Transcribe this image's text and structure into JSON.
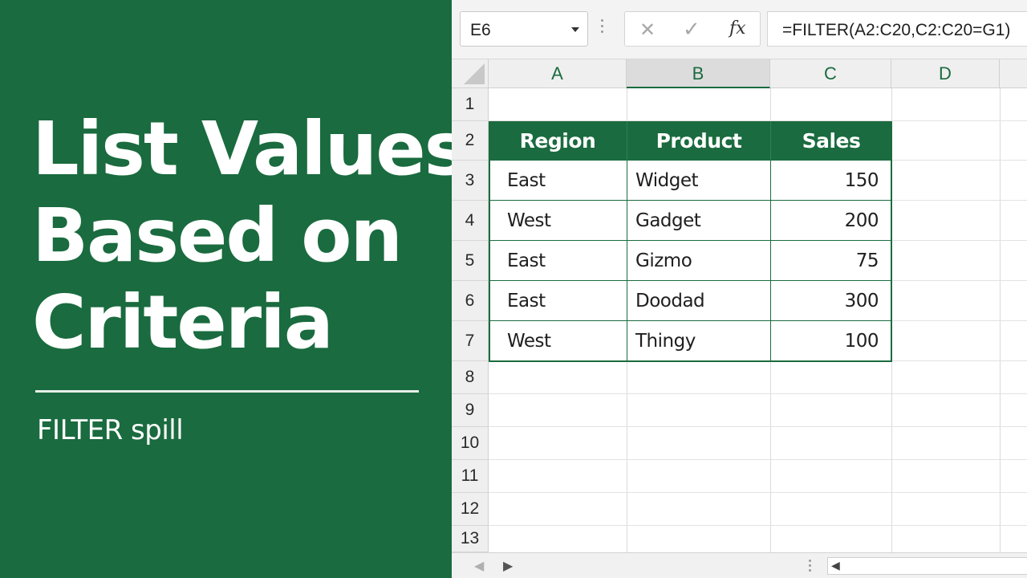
{
  "panel": {
    "title_lines": [
      "List Values",
      "Based on",
      "Criteria"
    ],
    "subtitle": "FILTER spill"
  },
  "formula_bar": {
    "name_box": "E6",
    "cancel_icon": "close-icon",
    "enter_icon": "check-icon",
    "fx_label": "fx",
    "formula": "=FILTER(A2:C20,C2:C20=G1)"
  },
  "grid": {
    "columns": [
      "A",
      "B",
      "C",
      "D"
    ],
    "active_column": "B",
    "rows": [
      "1",
      "2",
      "3",
      "4",
      "5",
      "6",
      "7",
      "8",
      "9",
      "10",
      "11",
      "12",
      "13"
    ]
  },
  "table": {
    "headers": [
      "Region",
      "Product",
      "Sales"
    ],
    "rows": [
      [
        "East",
        "Widget",
        "150"
      ],
      [
        "West",
        "Gadget",
        "200"
      ],
      [
        "East",
        "Gizmo",
        "75"
      ],
      [
        "East",
        "Doodad",
        "300"
      ],
      [
        "West",
        "Thingy",
        "100"
      ]
    ],
    "header_color": "#1a6b3f"
  },
  "colors": {
    "brand_green": "#1a6b3f"
  }
}
